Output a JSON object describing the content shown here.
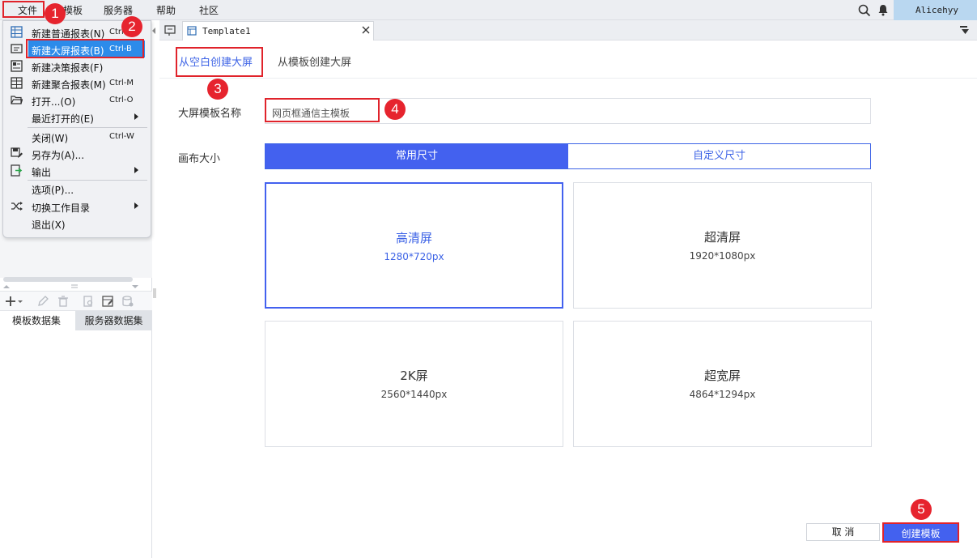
{
  "menubar": {
    "items": [
      "文件",
      "模板",
      "服务器",
      "帮助",
      "社区"
    ],
    "user": "Alicehyy"
  },
  "file_menu": {
    "items": [
      {
        "label": "新建普通报表(N)",
        "shortcut": "Ctrl"
      },
      {
        "label": "新建大屏报表(B)",
        "shortcut": "Ctrl-B"
      },
      {
        "label": "新建决策报表(F)",
        "shortcut": ""
      },
      {
        "label": "新建聚合报表(M)",
        "shortcut": "Ctrl-M"
      },
      {
        "label": "打开...(O)",
        "shortcut": "Ctrl-O"
      },
      {
        "label": "最近打开的(E)",
        "shortcut": ""
      },
      {
        "label": "关闭(W)",
        "shortcut": "Ctrl-W"
      },
      {
        "label": "另存为(A)...",
        "shortcut": ""
      },
      {
        "label": "输出",
        "shortcut": ""
      },
      {
        "label": "选项(P)...",
        "shortcut": ""
      },
      {
        "label": "切换工作目录",
        "shortcut": ""
      },
      {
        "label": "退出(X)",
        "shortcut": ""
      }
    ]
  },
  "sidebar": {
    "dataset_tabs": [
      "模板数据集",
      "服务器数据集"
    ]
  },
  "tabs": {
    "active": "Template1"
  },
  "main": {
    "tabs": [
      "从空白创建大屏",
      "从模板创建大屏"
    ],
    "name_label": "大屏模板名称",
    "name_value": "网页框通信主模板",
    "size_label": "画布大小",
    "size_modes": [
      "常用尺寸",
      "自定义尺寸"
    ],
    "cards": [
      {
        "title": "高清屏",
        "dim": "1280*720px"
      },
      {
        "title": "超清屏",
        "dim": "1920*1080px"
      },
      {
        "title": "2K屏",
        "dim": "2560*1440px"
      },
      {
        "title": "超宽屏",
        "dim": "4864*1294px"
      }
    ],
    "cancel": "取 消",
    "create": "创建模板"
  },
  "badges": [
    "1",
    "2",
    "3",
    "4",
    "5"
  ],
  "colors": {
    "accent": "#4361ef",
    "highlight": "#e0232b",
    "menu_selected": "#2c8bea"
  }
}
